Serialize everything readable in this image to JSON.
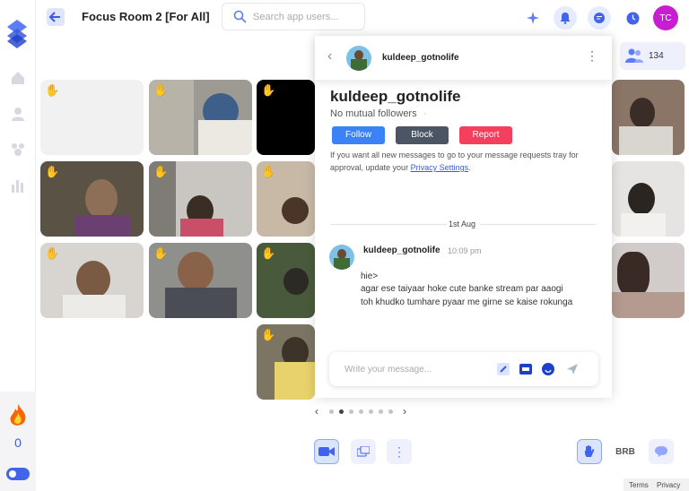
{
  "header": {
    "room_title": "Focus Room 2 [For All]",
    "search_placeholder": "Search app users...",
    "avatar_initials": "TC"
  },
  "rail": {
    "streak_count": "0"
  },
  "people": {
    "count": "134"
  },
  "chat": {
    "username": "kuldeep_gotnolife",
    "profile_name": "kuldeep_gotnolife",
    "mutual": "No mutual followers",
    "mutual_dot": "·",
    "follow_label": "Follow",
    "block_label": "Block",
    "report_label": "Report",
    "notice_text": "If you want all new messages to go to your message requests tray for approval, update your",
    "notice_link": "Privacy Settings",
    "notice_end": ".",
    "date_label": "1st Aug",
    "message": {
      "user": "kuldeep_gotnolife",
      "time": "10:09 pm",
      "lines": [
        "hie>",
        "agar ese taiyaar hoke cute banke stream par aaogi",
        "toh khudko tumhare pyaar me girne se kaise rokunga"
      ]
    },
    "compose_placeholder": "Write your message..."
  },
  "controls": {
    "brb_label": "BRB"
  },
  "footer": {
    "terms": "Terms",
    "privacy": "Privacy"
  },
  "colors": {
    "accent": "#4263eb",
    "follow": "#3b82f6",
    "block": "#4b5563",
    "report": "#f43f5e",
    "avatar": "#c81ed1"
  }
}
